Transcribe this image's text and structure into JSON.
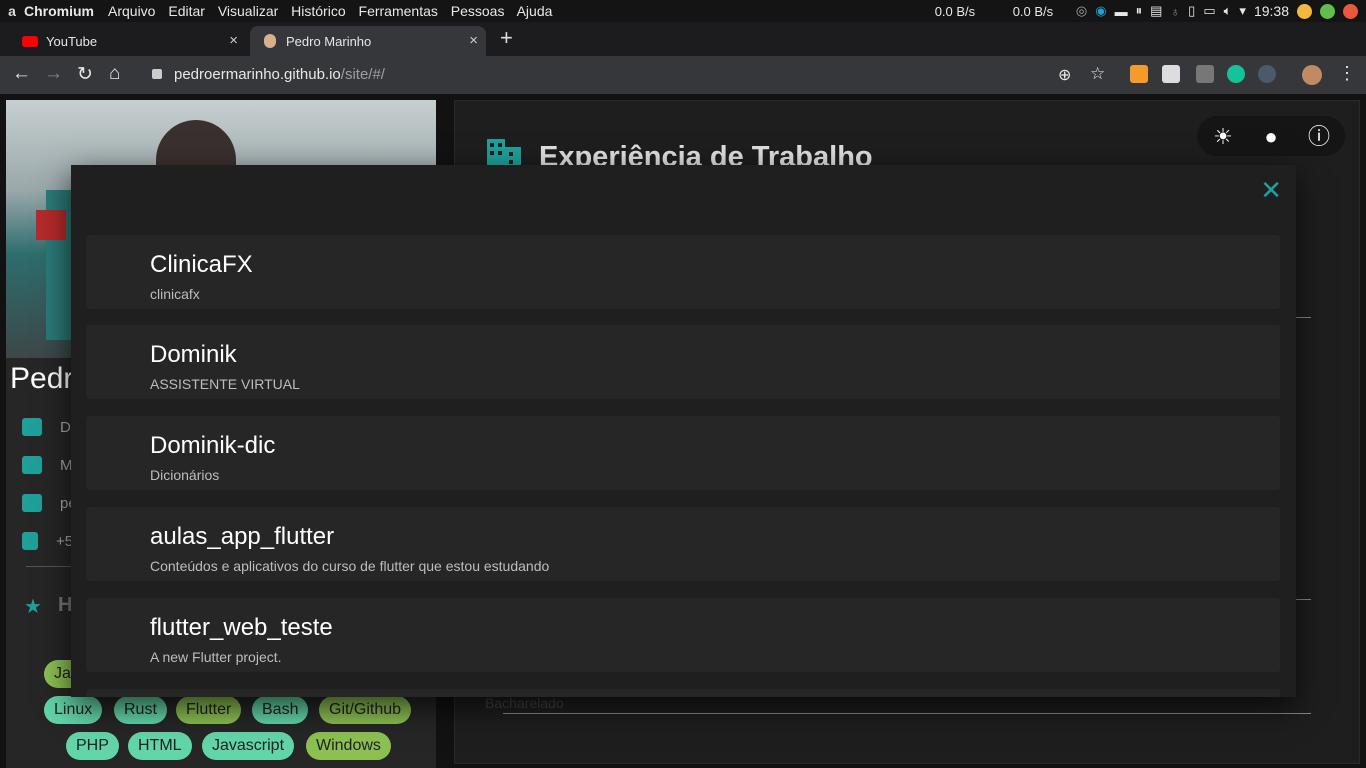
{
  "os": {
    "app_name": "Chromium",
    "menu": [
      "Arquivo",
      "Editar",
      "Visualizar",
      "Histórico",
      "Ferramentas",
      "Pessoas",
      "Ajuda"
    ],
    "net_down": "0.0 B/s",
    "net_up": "0.0 B/s",
    "clock": "19:38"
  },
  "tabs": [
    {
      "label": "YouTube",
      "close": "×"
    },
    {
      "label": "Pedro Marinho",
      "close": "×"
    }
  ],
  "newtab": "+",
  "address": {
    "host": "pedroermarinho.github.io",
    "path": "/site/#/"
  },
  "profile": {
    "name_fragment": "Pedr",
    "contacts": [
      "De",
      "M",
      "pe",
      "+5"
    ],
    "skills_heading": "H",
    "skills_row1": [
      "Linux",
      "Rust",
      "Flutter",
      "Bash",
      "Git/Github"
    ],
    "skills_row2": [
      "PHP",
      "HTML",
      "Javascript",
      "Windows"
    ],
    "skill_partial": "Jav"
  },
  "main": {
    "title": "Experiência de Trabalho",
    "hint_text": "Bacharelado"
  },
  "dialog": {
    "close_label": "✕",
    "repos": [
      {
        "name": "ClinicaFX",
        "description": "clinicafx"
      },
      {
        "name": "Dominik",
        "description": "ASSISTENTE VIRTUAL"
      },
      {
        "name": "Dominik-dic",
        "description": "Dicionários"
      },
      {
        "name": "aulas_app_flutter",
        "description": "Conteúdos e aplicativos do curso de flutter que estou estudando"
      },
      {
        "name": "flutter_web_teste",
        "description": "A new Flutter project."
      }
    ]
  },
  "colors": {
    "accent": "#20a09a",
    "chip_green": "#8cc152",
    "chip_teal": "#62d6a8"
  }
}
